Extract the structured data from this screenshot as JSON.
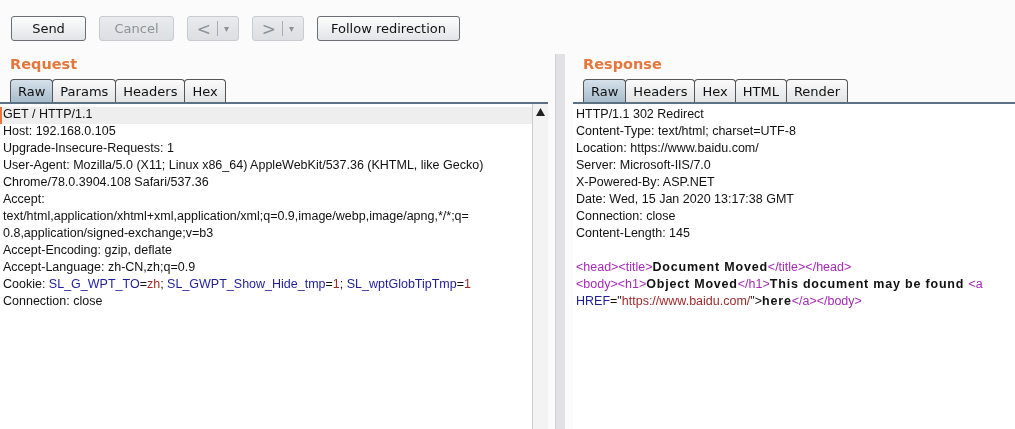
{
  "toolbar": {
    "buttons": [
      {
        "kind": "text",
        "label": "Send",
        "disabled": false
      },
      {
        "kind": "text",
        "label": "Cancel",
        "disabled": true
      },
      {
        "kind": "split",
        "label": "<",
        "menu": "▾",
        "disabled": true
      },
      {
        "kind": "split",
        "label": ">",
        "menu": "▾",
        "disabled": true
      },
      {
        "kind": "text",
        "label": "Follow redirection",
        "disabled": false
      }
    ]
  },
  "request": {
    "title": "Request",
    "tabs": [
      {
        "label": "Raw",
        "selected": true
      },
      {
        "label": "Params",
        "selected": false
      },
      {
        "label": "Headers",
        "selected": false
      },
      {
        "label": "Hex",
        "selected": false
      }
    ],
    "lines": [
      {
        "current": true,
        "segments": [
          {
            "kind": "plain",
            "text": "GET / HTTP/1.1"
          }
        ]
      },
      {
        "current": false,
        "segments": [
          {
            "kind": "plain",
            "text": "Host: 192.168.0.105"
          }
        ]
      },
      {
        "current": false,
        "segments": [
          {
            "kind": "plain",
            "text": "Upgrade-Insecure-Requests: 1"
          }
        ]
      },
      {
        "current": false,
        "segments": [
          {
            "kind": "plain",
            "text": "User-Agent: Mozilla/5.0 (X11; Linux x86_64) AppleWebKit/537.36 (KHTML, like Gecko)"
          }
        ]
      },
      {
        "current": false,
        "segments": [
          {
            "kind": "plain",
            "text": "Chrome/78.0.3904.108 Safari/537.36"
          }
        ]
      },
      {
        "current": false,
        "segments": [
          {
            "kind": "plain",
            "text": "Accept:"
          }
        ]
      },
      {
        "current": false,
        "segments": [
          {
            "kind": "plain",
            "text": "text/html,application/xhtml+xml,application/xml;q=0.9,image/webp,image/apng,*/*;q="
          }
        ]
      },
      {
        "current": false,
        "segments": [
          {
            "kind": "plain",
            "text": "0.8,application/signed-exchange;v=b3"
          }
        ]
      },
      {
        "current": false,
        "segments": [
          {
            "kind": "plain",
            "text": "Accept-Encoding: gzip, deflate"
          }
        ]
      },
      {
        "current": false,
        "segments": [
          {
            "kind": "plain",
            "text": "Accept-Language: zh-CN,zh;q=0.9"
          }
        ]
      },
      {
        "current": false,
        "segments": [
          {
            "kind": "plain",
            "text": "Cookie: "
          },
          {
            "kind": "name",
            "text": "SL_G_WPT_TO"
          },
          {
            "kind": "plain",
            "text": "="
          },
          {
            "kind": "value",
            "text": "zh"
          },
          {
            "kind": "plain",
            "text": "; "
          },
          {
            "kind": "name",
            "text": "SL_GWPT_Show_Hide_tmp"
          },
          {
            "kind": "plain",
            "text": "="
          },
          {
            "kind": "value",
            "text": "1"
          },
          {
            "kind": "plain",
            "text": "; "
          },
          {
            "kind": "name",
            "text": "SL_wptGlobTipTmp"
          },
          {
            "kind": "plain",
            "text": "="
          },
          {
            "kind": "value",
            "text": "1"
          }
        ]
      },
      {
        "current": false,
        "segments": [
          {
            "kind": "plain",
            "text": "Connection: close"
          }
        ]
      }
    ]
  },
  "response": {
    "title": "Response",
    "tabs": [
      {
        "label": "Raw",
        "selected": true
      },
      {
        "label": "Headers",
        "selected": false
      },
      {
        "label": "Hex",
        "selected": false
      },
      {
        "label": "HTML",
        "selected": false
      },
      {
        "label": "Render",
        "selected": false
      }
    ],
    "lines": [
      {
        "current": false,
        "segments": [
          {
            "kind": "plain",
            "text": "HTTP/1.1 302 Redirect"
          }
        ]
      },
      {
        "current": false,
        "segments": [
          {
            "kind": "plain",
            "text": "Content-Type: text/html; charset=UTF-8"
          }
        ]
      },
      {
        "current": false,
        "segments": [
          {
            "kind": "plain",
            "text": "Location: https://www.baidu.com/"
          }
        ]
      },
      {
        "current": false,
        "segments": [
          {
            "kind": "plain",
            "text": "Server: Microsoft-IIS/7.0"
          }
        ]
      },
      {
        "current": false,
        "segments": [
          {
            "kind": "plain",
            "text": "X-Powered-By: ASP.NET"
          }
        ]
      },
      {
        "current": false,
        "segments": [
          {
            "kind": "plain",
            "text": "Date: Wed, 15 Jan 2020 13:17:38 GMT"
          }
        ]
      },
      {
        "current": false,
        "segments": [
          {
            "kind": "plain",
            "text": "Connection: close"
          }
        ]
      },
      {
        "current": false,
        "segments": [
          {
            "kind": "plain",
            "text": "Content-Length: 145"
          }
        ]
      },
      {
        "current": false
      },
      {
        "current": false,
        "segments": [
          {
            "kind": "tag",
            "text": "<head><title>"
          },
          {
            "kind": "bold",
            "text": "Document Moved"
          },
          {
            "kind": "tag",
            "text": "</title></head>"
          }
        ]
      },
      {
        "current": false,
        "segments": [
          {
            "kind": "tag",
            "text": "<body><h1>"
          },
          {
            "kind": "bold",
            "text": "Object Moved"
          },
          {
            "kind": "tag",
            "text": "</h1>"
          },
          {
            "kind": "bold",
            "text": "This document may be found "
          },
          {
            "kind": "tag",
            "text": "<a"
          }
        ]
      },
      {
        "current": false,
        "segments": [
          {
            "kind": "name",
            "text": "HREF"
          },
          {
            "kind": "plain",
            "text": "=\""
          },
          {
            "kind": "value",
            "text": "https://www.baidu.com/"
          },
          {
            "kind": "plain",
            "text": "\">"
          },
          {
            "kind": "bold",
            "text": "here"
          },
          {
            "kind": "tag",
            "text": "</a></body>"
          }
        ]
      }
    ]
  }
}
